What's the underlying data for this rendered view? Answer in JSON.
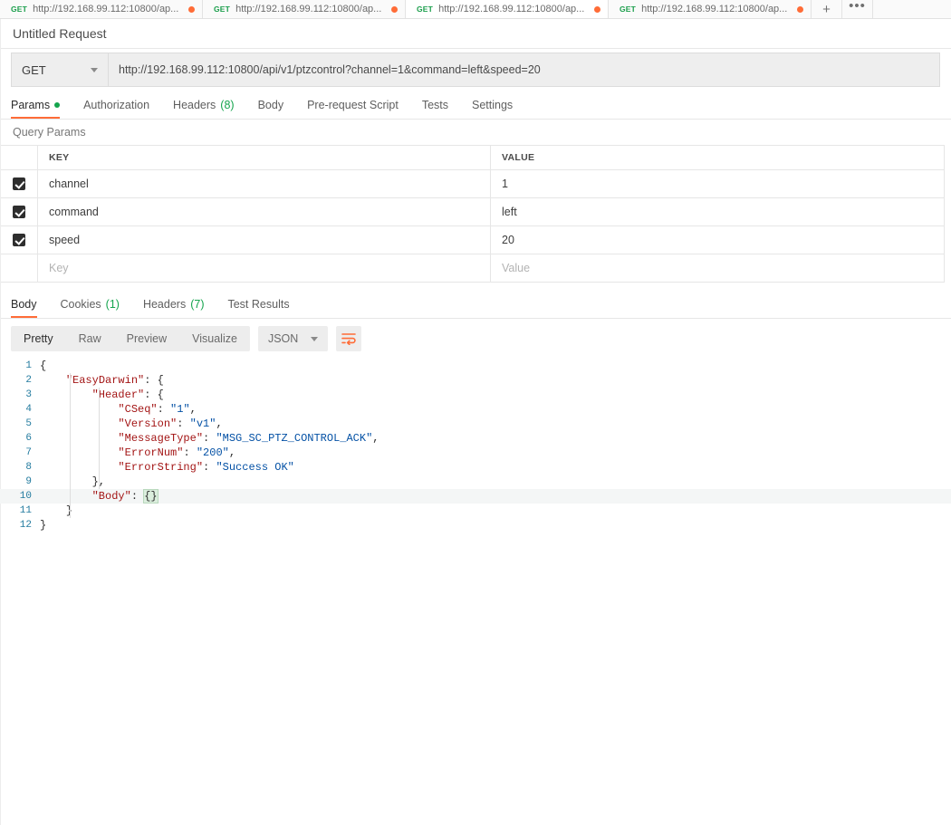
{
  "tabstrip": {
    "tabs": [
      {
        "method": "GET",
        "url": "http://192.168.99.112:10800/ap...",
        "unsaved": true,
        "active": false
      },
      {
        "method": "GET",
        "url": "http://192.168.99.112:10800/ap...",
        "unsaved": true,
        "active": false
      },
      {
        "method": "GET",
        "url": "http://192.168.99.112:10800/ap...",
        "unsaved": true,
        "active": true
      },
      {
        "method": "GET",
        "url": "http://192.168.99.112:10800/ap...",
        "unsaved": true,
        "active": false
      }
    ],
    "new_tab_label": "+",
    "more_label": "•••"
  },
  "request": {
    "name": "Untitled Request",
    "method": "GET",
    "url": "http://192.168.99.112:10800/api/v1/ptzcontrol?channel=1&command=left&speed=20"
  },
  "request_tabs": [
    {
      "label": "Params",
      "dot": true,
      "count": "",
      "active": true
    },
    {
      "label": "Authorization",
      "dot": false,
      "count": "",
      "active": false
    },
    {
      "label": "Headers",
      "dot": false,
      "count": "(8)",
      "active": false
    },
    {
      "label": "Body",
      "dot": false,
      "count": "",
      "active": false
    },
    {
      "label": "Pre-request Script",
      "dot": false,
      "count": "",
      "active": false
    },
    {
      "label": "Tests",
      "dot": false,
      "count": "",
      "active": false
    },
    {
      "label": "Settings",
      "dot": false,
      "count": "",
      "active": false
    }
  ],
  "query_params": {
    "section_title": "Query Params",
    "columns": {
      "key": "KEY",
      "value": "VALUE"
    },
    "rows": [
      {
        "checked": true,
        "key": "channel",
        "value": "1"
      },
      {
        "checked": true,
        "key": "command",
        "value": "left"
      },
      {
        "checked": true,
        "key": "speed",
        "value": "20"
      }
    ],
    "empty_row": {
      "key_placeholder": "Key",
      "value_placeholder": "Value"
    }
  },
  "response_tabs": [
    {
      "label": "Body",
      "count": "",
      "active": true
    },
    {
      "label": "Cookies",
      "count": "(1)",
      "active": false
    },
    {
      "label": "Headers",
      "count": "(7)",
      "active": false
    },
    {
      "label": "Test Results",
      "count": "",
      "active": false
    }
  ],
  "response_toolbar": {
    "views": [
      {
        "label": "Pretty",
        "active": true
      },
      {
        "label": "Raw",
        "active": false
      },
      {
        "label": "Preview",
        "active": false
      },
      {
        "label": "Visualize",
        "active": false
      }
    ],
    "format": "JSON",
    "wrap_icon": "word-wrap-icon"
  },
  "response_body": {
    "language": "json",
    "lines": [
      {
        "n": "1",
        "indent": 0,
        "html": "{"
      },
      {
        "n": "2",
        "indent": 1,
        "html": "\"EasyDarwin\": {"
      },
      {
        "n": "3",
        "indent": 2,
        "html": "\"Header\": {"
      },
      {
        "n": "4",
        "indent": 3,
        "html": "\"CSeq\": \"1\","
      },
      {
        "n": "5",
        "indent": 3,
        "html": "\"Version\": \"v1\","
      },
      {
        "n": "6",
        "indent": 3,
        "html": "\"MessageType\": \"MSG_SC_PTZ_CONTROL_ACK\","
      },
      {
        "n": "7",
        "indent": 3,
        "html": "\"ErrorNum\": \"200\","
      },
      {
        "n": "8",
        "indent": 3,
        "html": "\"ErrorString\": \"Success OK\""
      },
      {
        "n": "9",
        "indent": 2,
        "html": "},"
      },
      {
        "n": "10",
        "indent": 2,
        "html": "\"Body\": {}"
      },
      {
        "n": "11",
        "indent": 1,
        "html": "}"
      },
      {
        "n": "12",
        "indent": 0,
        "html": "}"
      }
    ],
    "highlighted_line": "10"
  },
  "colors": {
    "accent": "#ff6c37",
    "success": "#14a44d",
    "json_key": "#a31515",
    "json_string": "#0451a5",
    "line_number": "#237b9f"
  }
}
